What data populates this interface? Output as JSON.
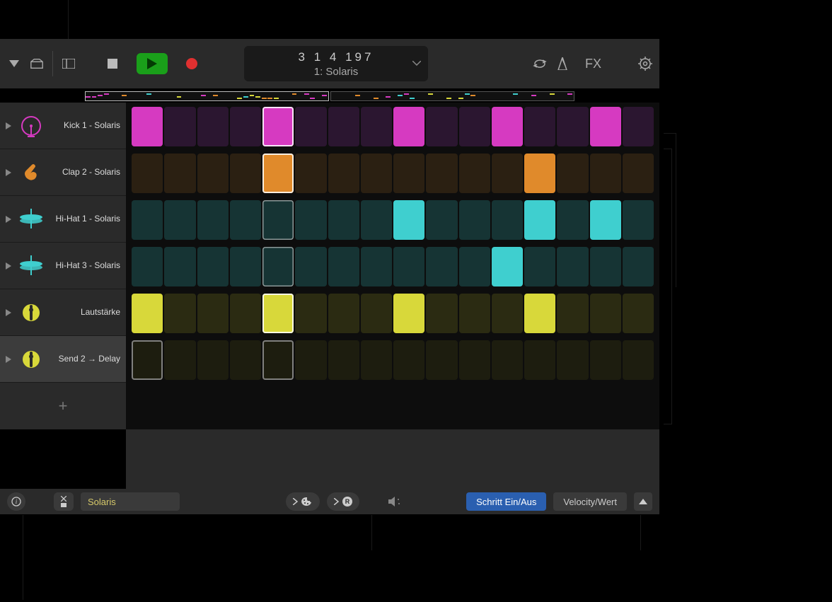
{
  "toolbar": {
    "lcd_position": "3  1  4  197",
    "lcd_patch": "1: Solaris",
    "fx_label": "FX"
  },
  "tracks": [
    {
      "label": "Kick 1 - Solaris",
      "color": "#d63ac1",
      "icon": "kick"
    },
    {
      "label": "Clap 2 - Solaris",
      "color": "#e08a2b",
      "icon": "clap"
    },
    {
      "label": "Hi-Hat 1 - Solaris",
      "color": "#3fcfcf",
      "icon": "hihat"
    },
    {
      "label": "Hi-Hat 3 - Solaris",
      "color": "#3fcfcf",
      "icon": "hihat"
    },
    {
      "label": "Lautstärke",
      "color": "#d8d83a",
      "icon": "knob"
    },
    {
      "label": "Send 2 → Delay",
      "color": "#d8d83a",
      "icon": "knob",
      "selected": true
    }
  ],
  "grid": {
    "cols": 16,
    "playhead_col": 4,
    "rows": [
      {
        "on_color": "#d63ac1",
        "off_color": "#2b1630",
        "on": [
          0,
          4,
          8,
          11,
          14
        ],
        "outlined": [
          4
        ]
      },
      {
        "on_color": "#e08a2b",
        "off_color": "#2b2012",
        "on": [
          4,
          12
        ],
        "outlined": [
          4
        ]
      },
      {
        "on_color": "#3fcfcf",
        "off_color": "#163434",
        "on": [
          8,
          12,
          14
        ],
        "outlined": [],
        "alloff_outlined": false
      },
      {
        "on_color": "#3fcfcf",
        "off_color": "#163434",
        "on": [
          11
        ],
        "outlined": []
      },
      {
        "on_color": "#d8d83a",
        "off_color": "#2b2b12",
        "on": [
          0,
          4,
          8,
          12
        ],
        "outlined": [
          4
        ]
      },
      {
        "on_color": "#d8d83a",
        "off_color": "#2b2b12",
        "on": [],
        "outlined": [
          0,
          4
        ],
        "dim": true
      }
    ]
  },
  "bottom": {
    "preset_name": "Solaris",
    "mode_primary": "Schritt Ein/Aus",
    "mode_secondary": "Velocity/Wert"
  },
  "icons": {
    "info": "i",
    "route_r": "R"
  }
}
